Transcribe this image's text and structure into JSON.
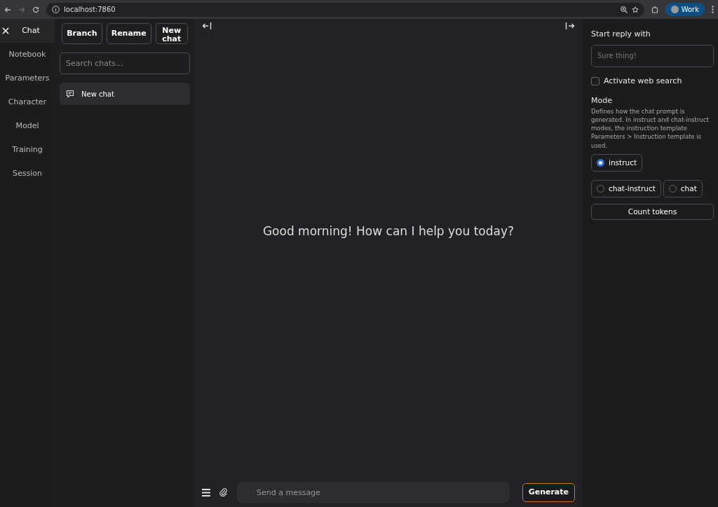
{
  "browser": {
    "url": "localhost:7860",
    "profile": "Work"
  },
  "tabs": [
    {
      "label": "Chat",
      "selected": true
    },
    {
      "label": "Notebook",
      "selected": false
    },
    {
      "label": "Parameters",
      "selected": false
    },
    {
      "label": "Character",
      "selected": false
    },
    {
      "label": "Model",
      "selected": false
    },
    {
      "label": "Training",
      "selected": false
    },
    {
      "label": "Session",
      "selected": false
    }
  ],
  "chat_actions": [
    "Branch",
    "Rename",
    "New chat"
  ],
  "search": {
    "placeholder": "Search chats..."
  },
  "chats": [
    {
      "title": "New chat",
      "selected": true
    }
  ],
  "greeting": "Good morning! How can I help you today?",
  "composer": {
    "placeholder": "Send a message",
    "button": "Generate"
  },
  "right_panel": {
    "start_reply_label": "Start reply with",
    "start_reply_placeholder": "Sure thing!",
    "web_search": {
      "label": "Activate web search",
      "checked": false
    },
    "mode_title": "Mode",
    "mode_help": "Defines how the chat prompt is generated. In instruct and chat-instruct modes, the instruction template Parameters > Instruction template is used.",
    "modes": [
      {
        "label": "instruct",
        "selected": true
      },
      {
        "label": "chat-instruct",
        "selected": false
      },
      {
        "label": "chat",
        "selected": false
      }
    ],
    "count_button": "Count tokens"
  }
}
